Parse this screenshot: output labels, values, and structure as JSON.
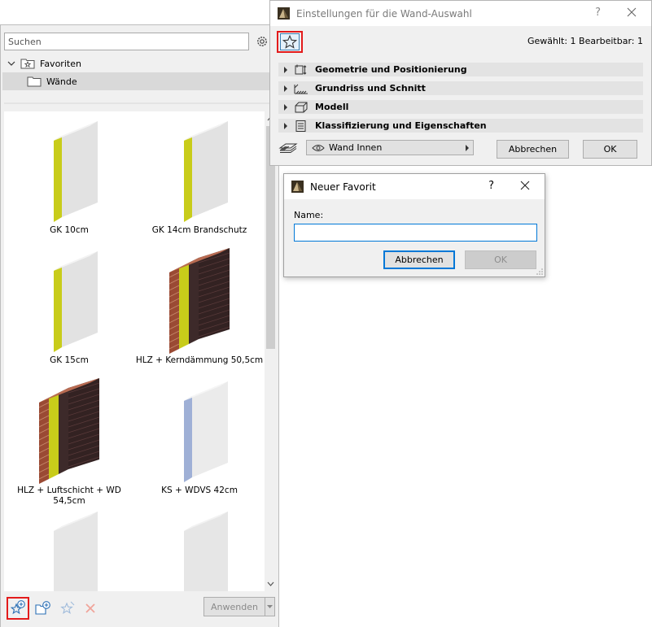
{
  "favorites_panel": {
    "search_placeholder": "Suchen",
    "tree": {
      "root_label": "Favoriten",
      "folder_label": "Wände"
    },
    "items": [
      {
        "label": "GK 10cm",
        "type": "gk"
      },
      {
        "label": "GK 14cm Brandschutz",
        "type": "gk"
      },
      {
        "label": "GK 15cm",
        "type": "gk"
      },
      {
        "label": "HLZ + Kerndämmung 50,5cm",
        "type": "hlz"
      },
      {
        "label": "HLZ + Luftschicht + WD 54,5cm",
        "type": "hlz"
      },
      {
        "label": "KS + WDVS 42cm",
        "type": "ks"
      },
      {
        "label": "",
        "type": "plain"
      },
      {
        "label": "",
        "type": "plain"
      }
    ],
    "bottom_bar": {
      "icons": [
        "new-favorite-icon",
        "new-folder-icon",
        "redefine-favorite-icon",
        "delete-icon"
      ],
      "apply_label": "Anwenden"
    }
  },
  "wall_dialog": {
    "title": "Einstellungen für die Wand-Auswahl",
    "help": "?",
    "selection_info": "Gewählt: 1 Bearbeitbar: 1",
    "sections": [
      {
        "label": "Geometrie und Positionierung",
        "icon": "geometry-icon"
      },
      {
        "label": "Grundriss und Schnitt",
        "icon": "floor-plan-icon"
      },
      {
        "label": "Modell",
        "icon": "model-icon"
      },
      {
        "label": "Klassifizierung und Eigenschaften",
        "icon": "classification-icon"
      }
    ],
    "layer_value": "Wand Innen",
    "cancel_label": "Abbrechen",
    "ok_label": "OK"
  },
  "new_favorite_dialog": {
    "title": "Neuer Favorit",
    "help": "?",
    "name_label": "Name:",
    "name_value": "",
    "cancel_label": "Abbrechen",
    "ok_label": "OK"
  },
  "colors": {
    "highlight_red": "#e31b1b",
    "accent_blue": "#0078d7",
    "insulation_yellow": "#c8cc1a",
    "brick": "#9a4a34",
    "plaster_blue": "#9fb0d6"
  }
}
